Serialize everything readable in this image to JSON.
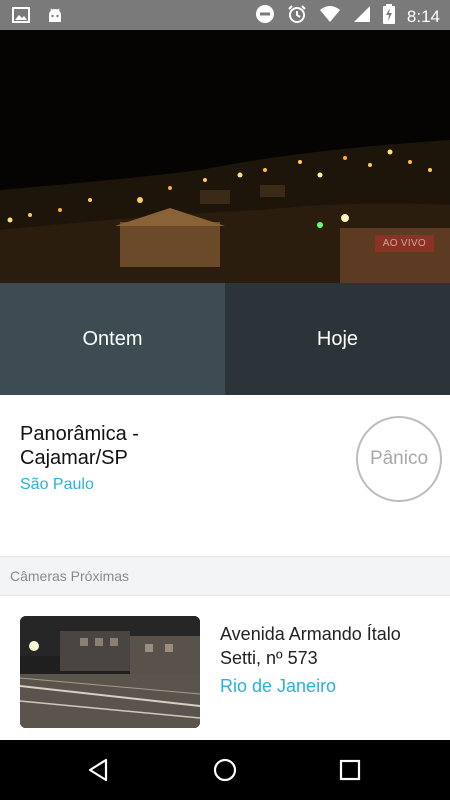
{
  "status_bar": {
    "time": "8:14",
    "left_icons": [
      "image-icon",
      "android-icon"
    ],
    "right_icons": [
      "do-not-disturb-icon",
      "alarm-icon",
      "wifi-icon",
      "signal-icon",
      "battery-charging-icon"
    ]
  },
  "video": {
    "live_badge": "AO VIVO"
  },
  "tabs": [
    {
      "label": "Ontem"
    },
    {
      "label": "Hoje"
    }
  ],
  "camera": {
    "title": "Panorâmica - Cajamar/SP",
    "city": "São Paulo",
    "panic_label": "Pânico"
  },
  "nearby": {
    "header": "Câmeras Próximas",
    "items": [
      {
        "title": "Avenida Armando Ítalo Setti, nº 573",
        "city": "Rio de Janeiro"
      }
    ]
  },
  "colors": {
    "accent": "#2ab0de",
    "tab_ontem": "#3d4b52",
    "tab_hoje": "#2b3438",
    "status_bar": "#7a7a7a"
  }
}
